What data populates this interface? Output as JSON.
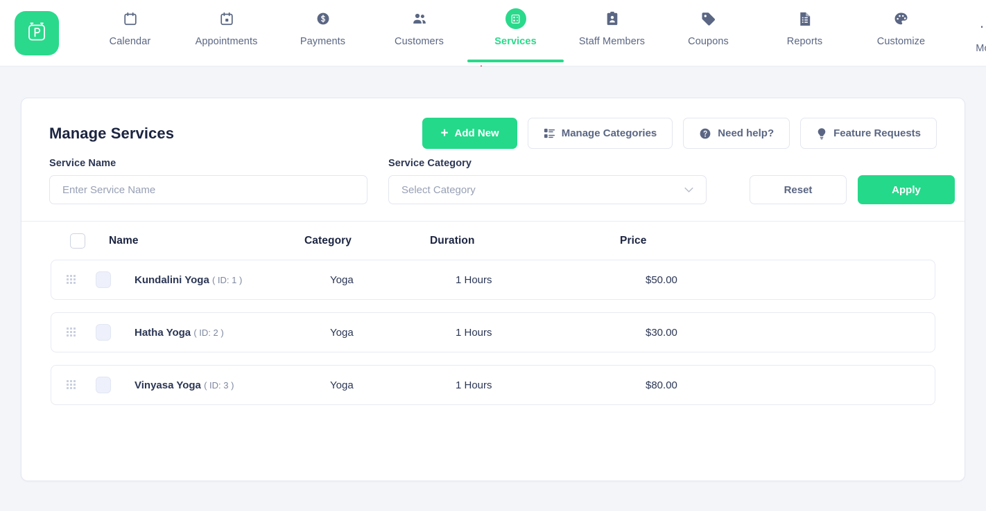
{
  "nav": {
    "logo_icon": "bookingpress-logo-icon",
    "items": [
      {
        "label": "Calendar",
        "icon": "calendar-icon",
        "active": false
      },
      {
        "label": "Appointments",
        "icon": "calendar-event-icon",
        "active": false
      },
      {
        "label": "Payments",
        "icon": "dollar-circle-icon",
        "active": false
      },
      {
        "label": "Customers",
        "icon": "people-icon",
        "active": false
      },
      {
        "label": "Services",
        "icon": "services-list-icon",
        "active": true
      },
      {
        "label": "Staff Members",
        "icon": "id-badge-icon",
        "active": false
      },
      {
        "label": "Coupons",
        "icon": "tag-icon",
        "active": false
      },
      {
        "label": "Reports",
        "icon": "report-file-icon",
        "active": false
      },
      {
        "label": "Customize",
        "icon": "palette-icon",
        "active": false
      },
      {
        "label": "More",
        "icon": "ellipsis-icon",
        "active": false
      }
    ],
    "active_color": "#2ad98b"
  },
  "annotation": {
    "arrow_icon": "red-up-arrow-annotation",
    "color": "#e8112d"
  },
  "header": {
    "title": "Manage Services",
    "add_new_label": "Add New",
    "add_new_icon": "plus-icon",
    "manage_categories_label": "Manage Categories",
    "manage_categories_icon": "categories-list-icon",
    "need_help_label": "Need help?",
    "need_help_icon": "question-circle-icon",
    "feature_requests_label": "Feature Requests",
    "feature_requests_icon": "lightbulb-icon"
  },
  "filters": {
    "service_name_label": "Service Name",
    "service_name_placeholder": "Enter Service Name",
    "service_name_value": "",
    "service_category_label": "Service Category",
    "service_category_value": "Select Category",
    "category_chevron_icon": "chevron-down-icon",
    "reset_label": "Reset",
    "apply_label": "Apply"
  },
  "table": {
    "select_all_icon": "checkbox-unchecked-icon",
    "columns": [
      "Name",
      "Category",
      "Duration",
      "Price"
    ],
    "rows": [
      {
        "drag_icon": "drag-handle-icon",
        "checkbox_icon": "checkbox-unchecked-icon",
        "name": "Kundalini Yoga",
        "id": "( ID: 1 )",
        "category": "Yoga",
        "duration": "1 Hours",
        "price": "$50.00"
      },
      {
        "drag_icon": "drag-handle-icon",
        "checkbox_icon": "checkbox-unchecked-icon",
        "name": "Hatha Yoga",
        "id": "( ID: 2 )",
        "category": "Yoga",
        "duration": "1 Hours",
        "price": "$30.00"
      },
      {
        "drag_icon": "drag-handle-icon",
        "checkbox_icon": "checkbox-unchecked-icon",
        "name": "Vinyasa Yoga",
        "id": "( ID: 3 )",
        "category": "Yoga",
        "duration": "1 Hours",
        "price": "$80.00"
      }
    ]
  },
  "theme": {
    "brand_green": "#24d98a",
    "page_bg": "#f3f5f9",
    "text_dark": "#1b2440",
    "text_muted": "#5a6683"
  }
}
